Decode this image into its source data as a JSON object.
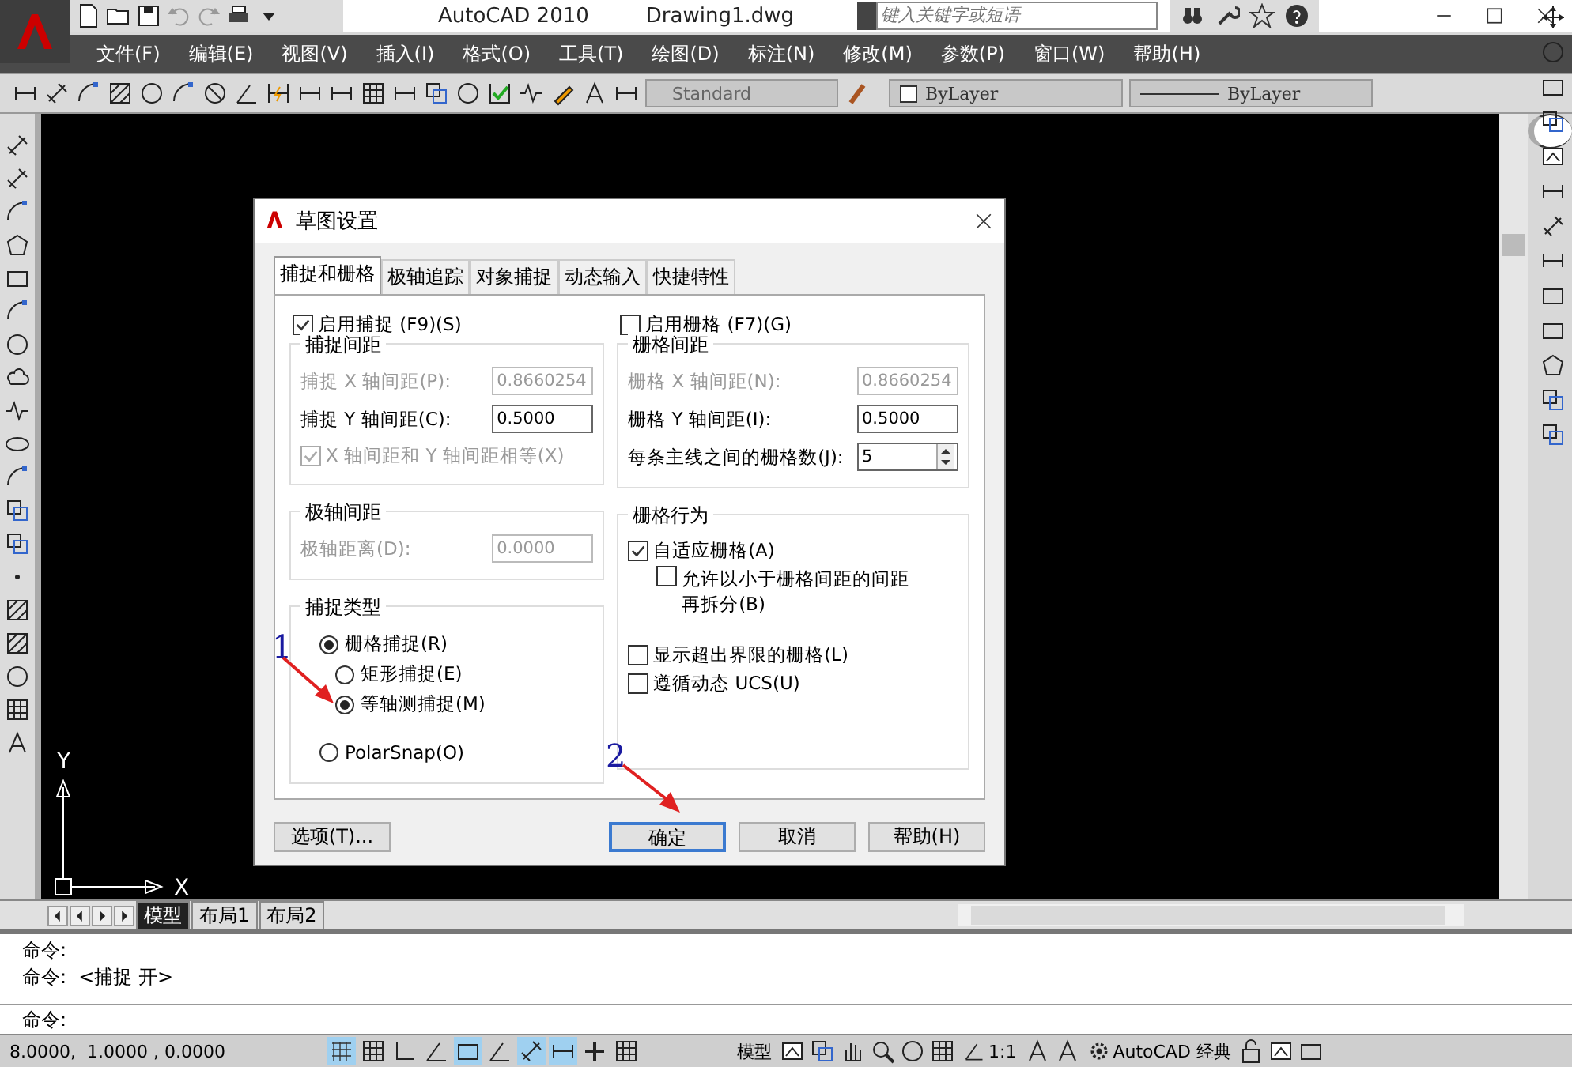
{
  "app": {
    "title": "AutoCAD 2010",
    "document": "Drawing1.dwg",
    "search": {
      "placeholder": "键入关键字或短语"
    }
  },
  "menu": [
    {
      "label": "文件(F)"
    },
    {
      "label": "编辑(E)"
    },
    {
      "label": "视图(V)"
    },
    {
      "label": "插入(I)"
    },
    {
      "label": "格式(O)"
    },
    {
      "label": "工具(T)"
    },
    {
      "label": "绘图(D)"
    },
    {
      "label": "标注(N)"
    },
    {
      "label": "修改(M)"
    },
    {
      "label": "参数(P)"
    },
    {
      "label": "窗口(W)"
    },
    {
      "label": "帮助(H)"
    }
  ],
  "toolbar": {
    "text_style": "Standard",
    "layer": "ByLayer",
    "linetype": "ByLayer"
  },
  "canvas": {
    "axis_y": "Y",
    "axis_x": "X"
  },
  "dialog": {
    "title": "草图设置",
    "tabs": [
      {
        "label": "捕捉和栅格",
        "selected": true
      },
      {
        "label": "极轴追踪",
        "selected": false
      },
      {
        "label": "对象捕捉",
        "selected": false
      },
      {
        "label": "动态输入",
        "selected": false
      },
      {
        "label": "快捷特性",
        "selected": false
      }
    ],
    "snap_on": {
      "label": "启用捕捉 (F9)(S)",
      "checked": true
    },
    "grid_on": {
      "label": "启用栅格 (F7)(G)",
      "checked": false
    },
    "snap_spacing": {
      "title": "捕捉间距",
      "fields": [
        {
          "label": "捕捉 X 轴间距(P):",
          "value": "0.8660254",
          "disabled": true
        },
        {
          "label": "捕捉 Y 轴间距(C):",
          "value": "0.5000",
          "disabled": false
        }
      ],
      "equal": {
        "label": "X 轴间距和 Y 轴间距相等(X)",
        "checked": true,
        "disabled": true
      }
    },
    "polar_spacing": {
      "title": "极轴间距",
      "fields": [
        {
          "label": "极轴距离(D):",
          "value": "0.0000",
          "disabled": true
        }
      ]
    },
    "snap_type": {
      "title": "捕捉类型",
      "options": [
        {
          "label": "栅格捕捉(R)",
          "selected": true,
          "children": [
            {
              "label": "矩形捕捉(E)",
              "selected": false
            },
            {
              "label": "等轴测捕捉(M)",
              "selected": true
            }
          ]
        },
        {
          "label": "PolarSnap(O)",
          "selected": false
        }
      ]
    },
    "grid_on_fields": {
      "title": "栅格间距",
      "fields": [
        {
          "label": "栅格 X 轴间距(N):",
          "value": "0.8660254",
          "disabled": true,
          "kind": "text"
        },
        {
          "label": "栅格 Y 轴间距(I):",
          "value": "0.5000",
          "disabled": false,
          "kind": "text"
        },
        {
          "label": "每条主线之间的栅格数(J):",
          "value": "5",
          "disabled": false,
          "kind": "spinner"
        }
      ]
    },
    "grid_behavior": {
      "title": "栅格行为",
      "options": [
        {
          "label": "自适应栅格(A)",
          "checked": true,
          "children": [
            {
              "label": "允许以小于栅格间距的间距再拆分(B)",
              "checked": false
            }
          ]
        },
        {
          "label": "显示超出界限的栅格(L)",
          "checked": false
        },
        {
          "label": "遵循动态 UCS(U)",
          "checked": false
        }
      ]
    },
    "options_button": "选项(T)...",
    "buttons": [
      {
        "label": "确定",
        "default": true
      },
      {
        "label": "取消",
        "default": false
      },
      {
        "label": "帮助(H)",
        "default": false
      }
    ]
  },
  "annotations": [
    {
      "label": "1"
    },
    {
      "label": "2"
    }
  ],
  "layout_tabs": [
    {
      "label": "模型",
      "selected": true
    },
    {
      "label": "布局1",
      "selected": false
    },
    {
      "label": "布局2",
      "selected": false
    }
  ],
  "command_lines": [
    "命令:",
    "命令:  <捕捉 开>"
  ],
  "command_prompt": "命令:",
  "status": {
    "coords": "8.0000,  1.0000 , 0.0000",
    "toggles": [
      {
        "on": true
      },
      {
        "on": false
      },
      {
        "on": false
      },
      {
        "on": false
      },
      {
        "on": true
      },
      {
        "on": false
      },
      {
        "on": true
      },
      {
        "on": true
      },
      {
        "on": false
      },
      {
        "on": false
      }
    ],
    "space": "模型",
    "scale": "1:1",
    "workspace": "AutoCAD 经典"
  }
}
